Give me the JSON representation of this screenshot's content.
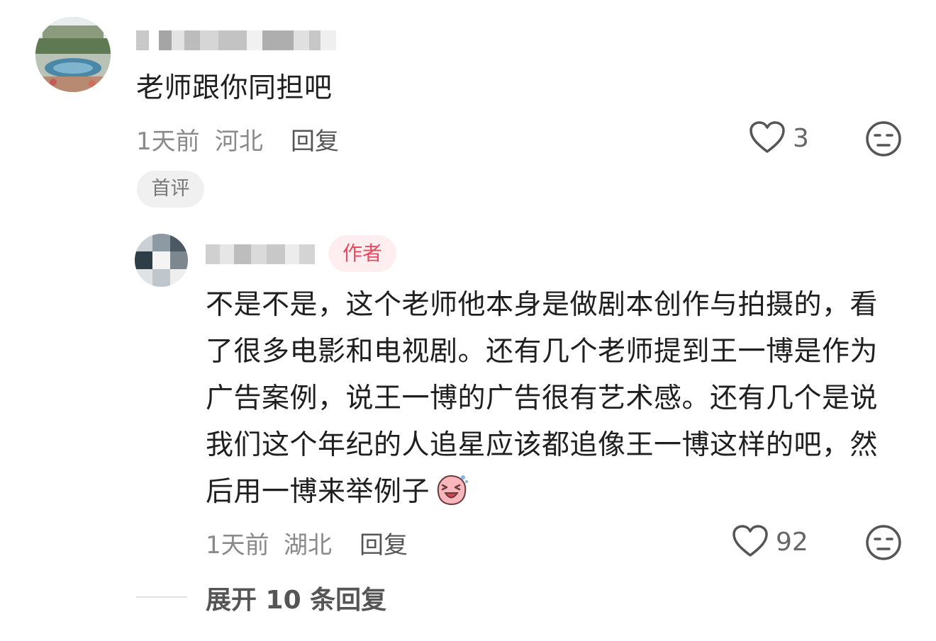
{
  "comment": {
    "text": "老师跟你同担吧",
    "time": "1天前",
    "location": "河北",
    "reply_label": "回复",
    "likes": "3",
    "badge": "首评"
  },
  "reply": {
    "badge": "作者",
    "text": "不是不是，这个老师他本身是做剧本创作与拍摄的，看了很多电影和电视剧。还有几个老师提到王一博是作为广告案例，说王一博的广告很有艺术感。还有几个是说我们这个年纪的人追星应该都追像王一博这样的吧，然后用一博来举例子",
    "time": "1天前",
    "location": "湖北",
    "reply_label": "回复",
    "likes": "92",
    "emoji": "laughing-face-sticker"
  },
  "expand_label": "展开 10 条回复",
  "icons": {
    "like": "heart-outline-icon",
    "dislike": "neutral-face-icon"
  },
  "colors": {
    "author_badge_bg": "#ffeef0",
    "author_badge_text": "#e74a61",
    "meta_text": "#8a8a8a"
  }
}
